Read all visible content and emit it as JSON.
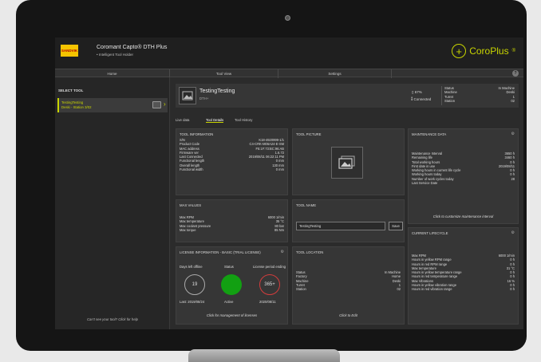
{
  "header": {
    "logo_text": "SANDVIK",
    "app_title": "Coromant Capto® DTH Plus",
    "app_subtitle": "• Intelligent Tool Holder",
    "brand": "CoroPlus",
    "brand_mark": "®",
    "plus_glyph": "+"
  },
  "nav": {
    "tabs": [
      "Home",
      "Tool View",
      "Settings"
    ],
    "help": "?"
  },
  "sidebar": {
    "title": "SELECT TOOL",
    "item_name": "TestingTesting",
    "item_station": "Deski - Station 3/02",
    "chevron": "›",
    "footer": "Can't see your tool? Click for help"
  },
  "tool": {
    "name": "TestingTesting",
    "type": "DTH+",
    "battery": "▯ 67%",
    "connection": "⁑ Connected",
    "status": [
      {
        "label": "Status",
        "value": "In Machine"
      },
      {
        "label": "Machine",
        "value": "Deski"
      },
      {
        "label": "Turret",
        "value": "1"
      },
      {
        "label": "Station",
        "value": "02"
      }
    ]
  },
  "subtabs": [
    "Live data",
    "Tool Details",
    "Tool History"
  ],
  "tool_information": {
    "title": "TOOL INFORMATION",
    "rows": [
      {
        "label": "S/N",
        "value": "K18-4920999-1/1"
      },
      {
        "label": "Product Code",
        "value": "C4-CRK-M06A24-E-SM"
      },
      {
        "label": "MAC address",
        "value": "F5:1F:73:BC:96:AB"
      },
      {
        "label": "Firmware ver",
        "value": "1.6.72"
      },
      {
        "label": "Last Connected",
        "value": "2019/08/11 06:22:11 PM"
      },
      {
        "label": "Functional length",
        "value": "0 mm"
      },
      {
        "label": "Overall length",
        "value": "130 mm"
      },
      {
        "label": "Functional width",
        "value": "0 mm"
      }
    ]
  },
  "tool_picture": {
    "title": "TOOL PICTURE"
  },
  "maintenance": {
    "title": "MAINTENANCE DATA",
    "rows": [
      {
        "label": "Maintenance Interval",
        "value": "3650 h"
      },
      {
        "label": "Remaining life",
        "value": "3460 h"
      },
      {
        "label": "Total working hours",
        "value": "0 h"
      },
      {
        "label": "First date in use",
        "value": "2019/08/11"
      },
      {
        "label": "Working hours in current life cycle",
        "value": "0 h"
      },
      {
        "label": "Working hours today",
        "value": "0 h"
      },
      {
        "label": "Number of work cycles today",
        "value": "28"
      },
      {
        "label": "Last Service Date",
        "value": ""
      }
    ],
    "footer": "Click to customize maintenance interval"
  },
  "max_values": {
    "title": "MAX VALUES",
    "rows": [
      {
        "label": "Max RPM",
        "value": "6000 1/min"
      },
      {
        "label": "Max temperature",
        "value": "35 °C"
      },
      {
        "label": "Max coolant pressure",
        "value": "80 bar"
      },
      {
        "label": "Max torque",
        "value": "85 Nm"
      }
    ]
  },
  "tool_name": {
    "title": "TOOL NAME",
    "input_value": "TestingTesting",
    "save_label": "Save"
  },
  "current_lifecycle": {
    "title": "CURRENT LIFECYCLE",
    "rows": [
      {
        "label": "Max RPM",
        "value": "6000 1/min"
      },
      {
        "label": "Hours in yellow RPM range",
        "value": "0 h"
      },
      {
        "label": "Hours in red RPM range",
        "value": "0 h"
      },
      {
        "label": "Max temperature",
        "value": "31 °C"
      },
      {
        "label": "Hours in yellow temperature range",
        "value": "0 h"
      },
      {
        "label": "Hours in red temperature range",
        "value": "0 h"
      },
      {
        "label": "Max Vibrations",
        "value": "16 %"
      },
      {
        "label": "Hours in yellow vibration range",
        "value": "0 h"
      },
      {
        "label": "Hours in red vibration range",
        "value": "0 h"
      }
    ]
  },
  "license": {
    "title": "LICENSE INFORMATION - BASIC (TRIAL LICENSE)",
    "days_left_label": "Days left offline",
    "days_left_value": "19",
    "last_label": "Last: 2019/08/24",
    "status_label": "Status",
    "status_value": "Active",
    "licence_label": "License period ending",
    "licence_value": "365+",
    "licence_date": "2020/08/11",
    "footer": "Click for management of licenses",
    "colors": {
      "active": "#12a012",
      "ring_days": "#aaaaaa",
      "ring_period": "#d23c3c"
    }
  },
  "tool_location": {
    "title": "TOOL LOCATION",
    "rows": [
      {
        "label": "Status",
        "value": "In Machine"
      },
      {
        "label": "Factory",
        "value": "Home"
      },
      {
        "label": "Machine",
        "value": "Deski"
      },
      {
        "label": "Turret",
        "value": "1"
      },
      {
        "label": "Station",
        "value": "02"
      }
    ],
    "footer": "Click to Edit"
  },
  "accent_color": "#c8d400"
}
